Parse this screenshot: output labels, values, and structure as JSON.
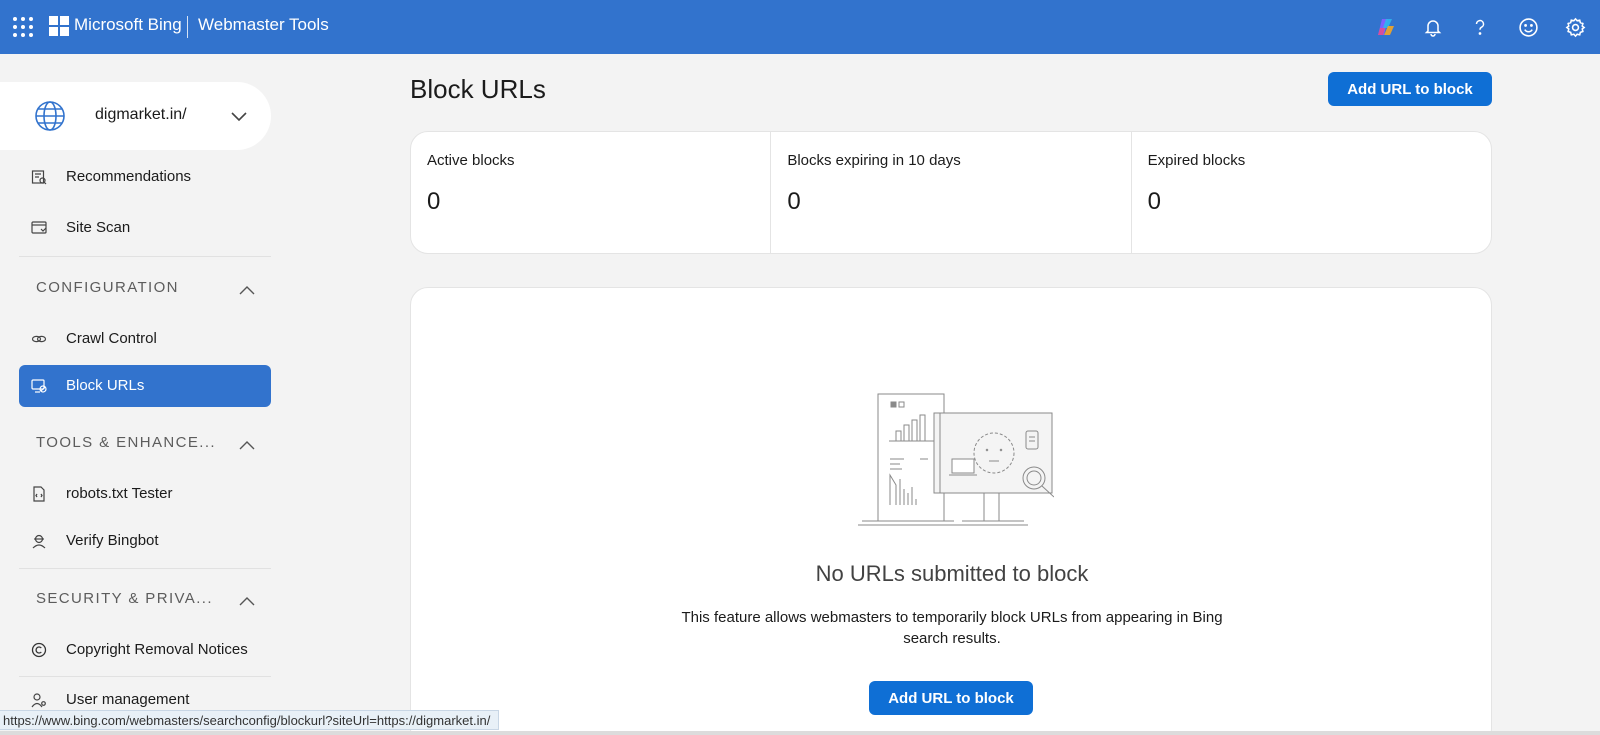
{
  "header": {
    "brand": "Microsoft Bing",
    "product": "Webmaster Tools",
    "icons": [
      "apps-waffle-icon",
      "copilot-icon",
      "notifications-bell-icon",
      "help-icon",
      "feedback-smiley-icon",
      "settings-gear-icon"
    ],
    "bar_color": "#3273cd"
  },
  "sidebar": {
    "site": "digmarket.in/",
    "items_top": [
      {
        "label": "Recommendations",
        "icon": "recommendations-icon"
      },
      {
        "label": "Site Scan",
        "icon": "site-scan-icon"
      }
    ],
    "sections": [
      {
        "title": "CONFIGURATION",
        "items": [
          {
            "label": "Crawl Control",
            "icon": "crawl-control-icon"
          },
          {
            "label": "Block URLs",
            "icon": "block-urls-icon",
            "active": true
          }
        ]
      },
      {
        "title": "TOOLS & ENHANCE...",
        "items": [
          {
            "label": "robots.txt Tester",
            "icon": "robots-file-icon"
          },
          {
            "label": "Verify Bingbot",
            "icon": "bingbot-icon"
          }
        ]
      },
      {
        "title": "SECURITY & PRIVA...",
        "items": [
          {
            "label": "Copyright Removal Notices",
            "icon": "copyright-icon"
          },
          {
            "label": "User management",
            "icon": "user-management-icon"
          }
        ]
      }
    ],
    "active_color": "#3273cd"
  },
  "main": {
    "title": "Block URLs",
    "add_button": "Add URL to block",
    "stats": [
      {
        "label": "Active blocks",
        "value": "0"
      },
      {
        "label": "Blocks expiring in 10 days",
        "value": "0"
      },
      {
        "label": "Expired blocks",
        "value": "0"
      }
    ],
    "empty": {
      "title": "No URLs submitted to block",
      "description": "This feature allows webmasters to temporarily block URLs from appearing in Bing search results.",
      "button": "Add URL to block"
    },
    "button_color": "#0f6fd5"
  },
  "status_bar": {
    "url": "https://www.bing.com/webmasters/searchconfig/blockurl?siteUrl=https://digmarket.in/"
  }
}
